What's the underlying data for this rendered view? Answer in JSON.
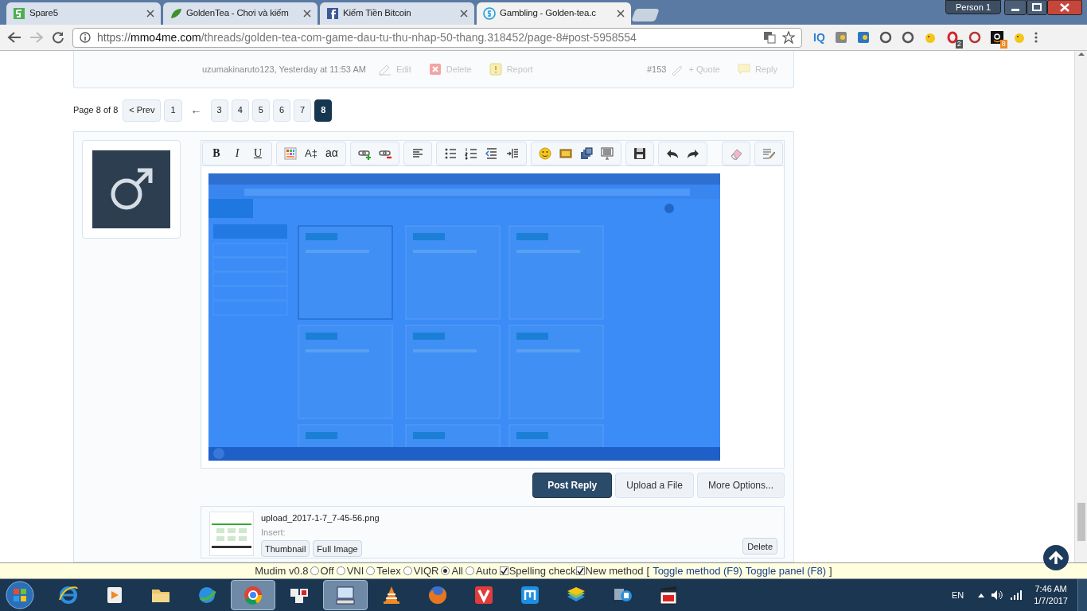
{
  "browser": {
    "tabs": [
      {
        "title": "Spare5",
        "kind": "five",
        "selected": false
      },
      {
        "title": "GoldenTea - Chơi và kiếm",
        "kind": "leaf",
        "selected": false
      },
      {
        "title": "Kiếm Tiền Bitcoin",
        "kind": "facebook",
        "selected": false
      },
      {
        "title": "Gambling - Golden-tea.c",
        "kind": "coin",
        "selected": true
      }
    ],
    "profile": "Person 1",
    "url_scheme": "https://",
    "url_host": "mmo4me.com",
    "url_path": "/threads/golden-tea-com-game-dau-tu-thu-nhap-50-thang.318452/page-8#post-5958554",
    "extensions": [
      {
        "kind": "iq",
        "label": "IQ"
      },
      {
        "kind": "square"
      },
      {
        "kind": "square"
      },
      {
        "kind": "ring"
      },
      {
        "kind": "ring"
      },
      {
        "kind": "chick"
      },
      {
        "kind": "opera",
        "badge": "2"
      },
      {
        "kind": "ring"
      },
      {
        "kind": "amazon",
        "badge": "8"
      },
      {
        "kind": "chick"
      }
    ]
  },
  "post_footer": {
    "author_line": "uzumakinaruto123, Yesterday at 11:53 AM",
    "actions": [
      {
        "kind": "edit",
        "label": "Edit"
      },
      {
        "kind": "delete",
        "label": "Delete"
      },
      {
        "kind": "report",
        "label": "Report"
      }
    ],
    "post_number": "#153",
    "right_actions": [
      {
        "kind": "quote",
        "label": "+ Quote"
      },
      {
        "kind": "reply",
        "label": "Reply"
      }
    ]
  },
  "pagination": {
    "label": "Page 8 of 8",
    "prev": "< Prev",
    "pages": [
      {
        "kind": "page",
        "label": "1",
        "selected": false
      },
      {
        "kind": "skip",
        "label": "←",
        "selected": false
      },
      {
        "kind": "page",
        "label": "3",
        "selected": false
      },
      {
        "kind": "page",
        "label": "4",
        "selected": false
      },
      {
        "kind": "page",
        "label": "5",
        "selected": false
      },
      {
        "kind": "page",
        "label": "6",
        "selected": false
      },
      {
        "kind": "page",
        "label": "7",
        "selected": false
      },
      {
        "kind": "page",
        "label": "8",
        "selected": true
      }
    ]
  },
  "editor": {
    "toolbar_groups": [
      [
        {
          "kind": "bold",
          "label": "B"
        },
        {
          "kind": "italic",
          "label": "I"
        },
        {
          "kind": "underline",
          "label": "U"
        }
      ],
      [
        {
          "kind": "color"
        },
        {
          "kind": "size",
          "label": "A‡"
        },
        {
          "kind": "font",
          "label": "aα"
        }
      ],
      [
        {
          "kind": "link"
        },
        {
          "kind": "unlink"
        }
      ],
      [
        {
          "kind": "align"
        }
      ],
      [
        {
          "kind": "bullets"
        },
        {
          "kind": "numbers"
        },
        {
          "kind": "outdent"
        },
        {
          "kind": "indent"
        }
      ],
      [
        {
          "kind": "smiley"
        },
        {
          "kind": "image"
        },
        {
          "kind": "media"
        },
        {
          "kind": "quote"
        }
      ],
      [
        {
          "kind": "save"
        }
      ],
      [
        {
          "kind": "undo"
        },
        {
          "kind": "redo"
        }
      ]
    ],
    "toolbar_right": [
      {
        "kind": "eraser"
      },
      {
        "kind": "switch"
      }
    ]
  },
  "buttons": [
    {
      "label": "Post Reply",
      "primary": true
    },
    {
      "label": "Upload a File",
      "primary": false
    },
    {
      "label": "More Options...",
      "primary": false
    }
  ],
  "attachment": {
    "filename": "upload_2017-1-7_7-45-56.png",
    "insert_label": "Insert:",
    "insert_buttons": [
      "Thumbnail",
      "Full Image"
    ],
    "delete": "Delete"
  },
  "mudim": {
    "title": "Mudim v0.8",
    "modes": [
      {
        "label": "Off",
        "selected": false
      },
      {
        "label": "VNI",
        "selected": false
      },
      {
        "label": "Telex",
        "selected": false
      },
      {
        "label": "VIQR",
        "selected": false
      },
      {
        "label": "All",
        "selected": true
      },
      {
        "label": "Auto",
        "selected": false
      }
    ],
    "options": [
      {
        "label": "Spelling check",
        "checked": true
      },
      {
        "label": "New method",
        "checked": true
      }
    ],
    "open_bracket": "[",
    "links": [
      "Toggle method (F9)",
      "Toggle panel (F8)"
    ],
    "close_bracket": "]"
  },
  "taskbar": {
    "apps": [
      {
        "kind": "ie",
        "active": false
      },
      {
        "kind": "media",
        "active": false
      },
      {
        "kind": "folder",
        "active": false
      },
      {
        "kind": "globe",
        "active": false
      },
      {
        "kind": "chrome",
        "active": true
      },
      {
        "kind": "unikey",
        "active": false
      },
      {
        "kind": "keyboard",
        "active": true
      },
      {
        "kind": "cone",
        "active": false
      },
      {
        "kind": "firefox",
        "active": false
      },
      {
        "kind": "vivaldi",
        "active": false
      },
      {
        "kind": "maxthon",
        "active": false
      },
      {
        "kind": "stack",
        "active": false
      },
      {
        "kind": "network",
        "active": false
      },
      {
        "kind": "clapper",
        "active": false
      }
    ],
    "language": "EN",
    "time": "7:46 AM",
    "date": "1/7/2017"
  }
}
